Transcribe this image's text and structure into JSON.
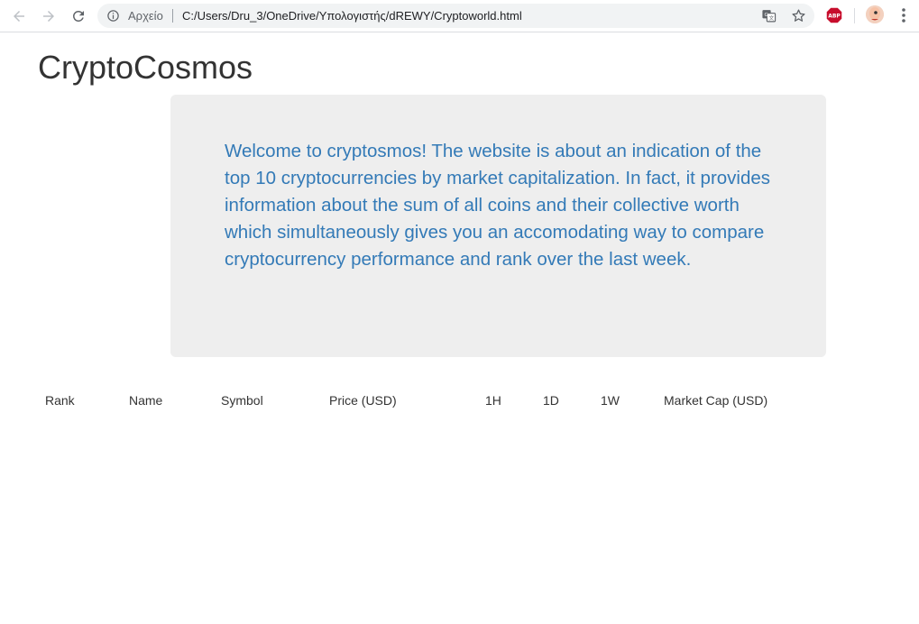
{
  "browser": {
    "scheme_label": "Αρχείο",
    "url": "C:/Users/Dru_3/OneDrive/Υπολογιστής/dREWY/Cryptoworld.html",
    "extension_label": "ABP"
  },
  "page": {
    "title": "CryptoCosmos",
    "intro": "Welcome to cryptosmos! The website is about an indication of the top 10 cryptocurrencies by market capitalization. In fact, it provides information about the sum of all coins and their collective worth which simultaneously gives you an accomodating way to compare cryptocurrency performance and rank over the last week."
  },
  "table": {
    "headers": [
      "Rank",
      "Name",
      "Symbol",
      "Price (USD)",
      "1H",
      "1D",
      "1W",
      "Market Cap (USD)"
    ]
  },
  "colors": {
    "accent_text": "#337ab7",
    "jumbotron_bg": "#eeeeee",
    "abp_red": "#c70d2c"
  }
}
